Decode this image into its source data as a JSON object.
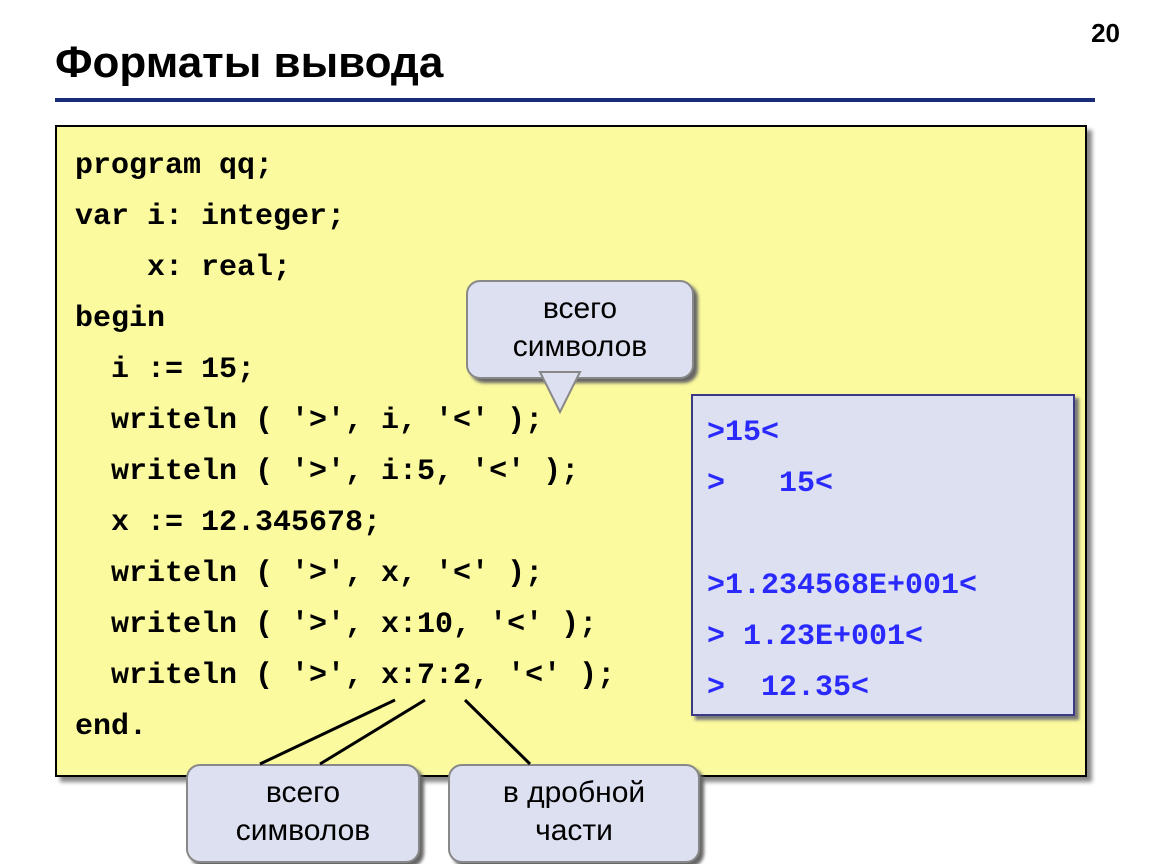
{
  "pageNumber": "20",
  "title": "Форматы вывода",
  "codeLines": [
    "program qq;",
    "var i: integer;",
    "    x: real;",
    "begin",
    "  i := 15;",
    "  writeln ( '>', i, '<' );",
    "  writeln ( '>', i:5, '<' );",
    "  x := 12.345678;",
    "  writeln ( '>', x, '<' );",
    "  writeln ( '>', x:10, '<' );",
    "  writeln ( '>', x:7:2, '<' );",
    "end."
  ],
  "outputLines": [
    ">15<",
    ">   15<",
    "",
    ">1.234568E+001<",
    "> 1.23E+001<",
    ">  12.35<"
  ],
  "callouts": {
    "topTotal": "всего\nсимволов",
    "bottomTotal": "всего\nсимволов",
    "bottomFraction": "в дробной\nчасти"
  }
}
